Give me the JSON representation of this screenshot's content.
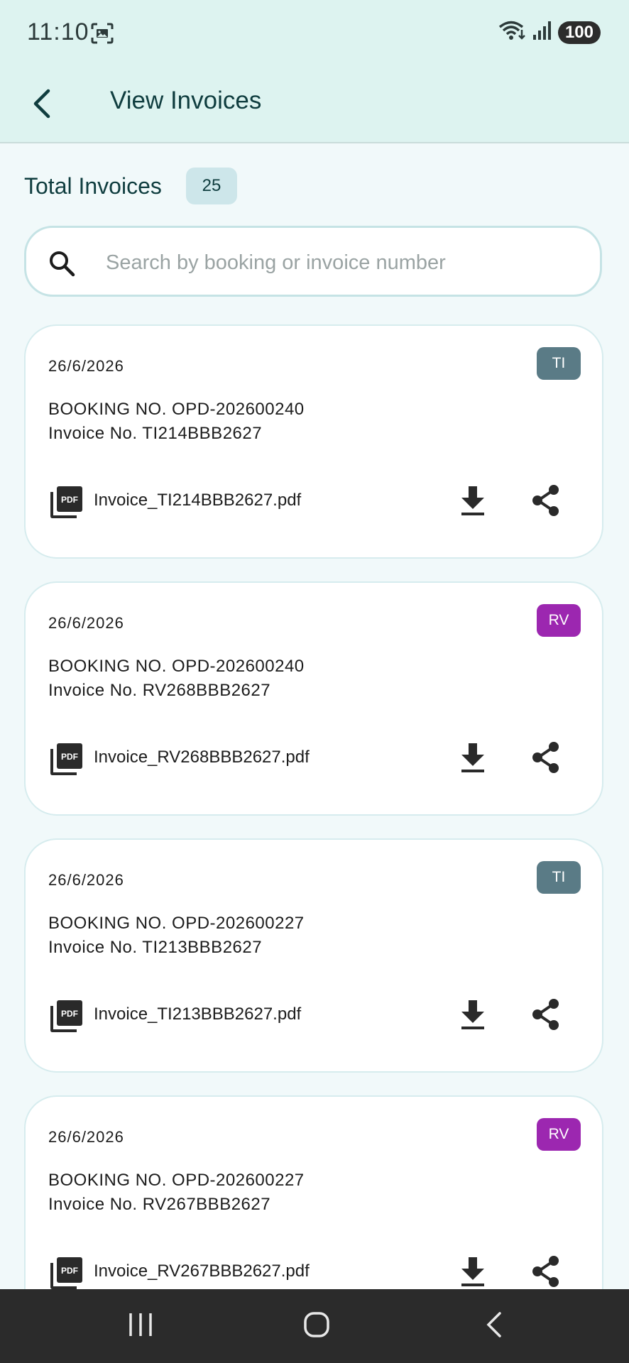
{
  "status": {
    "time": "11:10",
    "battery": "100",
    "icons": [
      "screenshot-icon",
      "wifi-icon",
      "signal-icon",
      "battery-icon"
    ]
  },
  "header": {
    "title": "View Invoices",
    "back_icon": "chevron-left-icon"
  },
  "summary": {
    "label": "Total Invoices",
    "count": "25"
  },
  "search": {
    "placeholder": "Search by booking or invoice number",
    "value": ""
  },
  "invoices": [
    {
      "date": "26/6/2026",
      "tag": "TI",
      "booking": "BOOKING NO. OPD-202600240",
      "invoice": "Invoice No. TI214BBB2627",
      "file": "Invoice_TI214BBB2627.pdf"
    },
    {
      "date": "26/6/2026",
      "tag": "RV",
      "booking": "BOOKING NO. OPD-202600240",
      "invoice": "Invoice No. RV268BBB2627",
      "file": "Invoice_RV268BBB2627.pdf"
    },
    {
      "date": "26/6/2026",
      "tag": "TI",
      "booking": "BOOKING NO. OPD-202600227",
      "invoice": "Invoice No. TI213BBB2627",
      "file": "Invoice_TI213BBB2627.pdf"
    },
    {
      "date": "26/6/2026",
      "tag": "RV",
      "booking": "BOOKING NO. OPD-202600227",
      "invoice": "Invoice No. RV267BBB2627",
      "file": "Invoice_RV267BBB2627.pdf"
    }
  ],
  "colors": {
    "header_bg": "#ddf3f0",
    "page_bg": "#f1f9fa",
    "title": "#0f3d3f",
    "tag_ti": "#5a7b86",
    "tag_rv": "#9c27b0",
    "navbar": "#2b2b2b"
  },
  "navigation": {
    "buttons": [
      "recent-apps-icon",
      "home-icon",
      "back-icon"
    ]
  }
}
